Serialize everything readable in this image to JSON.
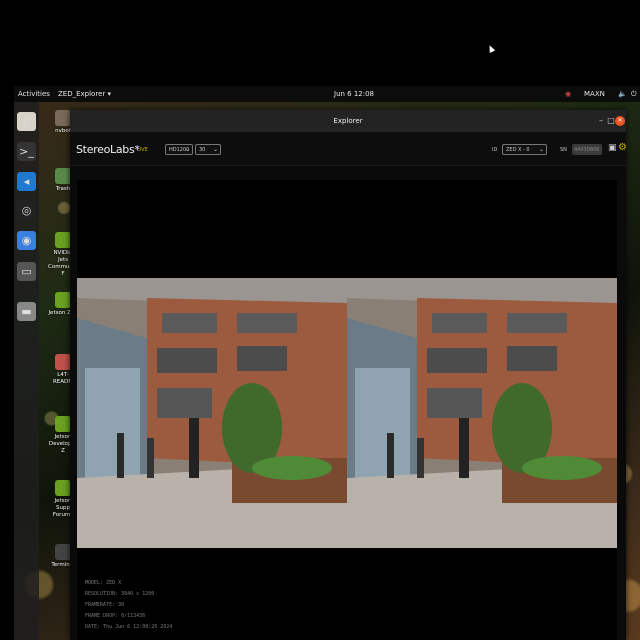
{
  "topbar": {
    "activities": "Activities",
    "app_menu": "ZED_Explorer ▾",
    "clock": "Jun 6  12:08",
    "power_mode": "MAXN",
    "status_icons": "🔈 ⏻"
  },
  "dock": {
    "items": [
      {
        "icon": "files-icon",
        "glyph": "▯",
        "color": "#d8d2c8"
      },
      {
        "icon": "terminal-icon",
        "glyph": ">_",
        "color": "#333"
      },
      {
        "icon": "vscode-icon",
        "glyph": "◂",
        "color": "#1e7ad0"
      },
      {
        "icon": "obs-icon",
        "glyph": "◎",
        "color": "#222"
      },
      {
        "icon": "chromium-icon",
        "glyph": "◉",
        "color": "#3a7ee0"
      },
      {
        "icon": "app-icon",
        "glyph": "▭",
        "color": "#555"
      },
      {
        "icon": "drive-icon",
        "glyph": "▬",
        "color": "#888"
      }
    ]
  },
  "desktop": {
    "icons": [
      {
        "label": "nvbot",
        "icon": "home-folder-icon",
        "color": "#7a6a5a"
      },
      {
        "label": "Trash",
        "icon": "trash-icon",
        "color": "#5a8a4a"
      },
      {
        "label": "NVIDIA Jets\nCommunity F",
        "icon": "nvidia-icon",
        "color": "#6aa121"
      },
      {
        "label": "Jetson Zoo",
        "icon": "nvidia-icon",
        "color": "#6aa121"
      },
      {
        "label": "L4T-READM",
        "icon": "folder-icon",
        "color": "#c0504a"
      },
      {
        "label": "Jetson\nDeveloper Z",
        "icon": "nvidia-icon",
        "color": "#6aa121"
      },
      {
        "label": "Jetson Supp\nForums",
        "icon": "nvidia-icon",
        "color": "#6aa121"
      },
      {
        "label": "Terminal",
        "icon": "terminal-icon",
        "color": "#444"
      }
    ]
  },
  "window": {
    "title": "Explorer",
    "minimize": "–",
    "maximize": "□",
    "close": "×"
  },
  "toolbar": {
    "brand": "StereoLabs*",
    "live": "LIVE",
    "resolution": "HD1200",
    "fps": "30",
    "sn_label": "ID",
    "serial_select": "ZED X - 0",
    "sn_badge": "SN",
    "sn_value": "44030806"
  },
  "info": {
    "model": "MODEL: ZED X",
    "resolution": "RESOLUTION: 3840 x 1200",
    "framerate": "FRAMERATE: 30",
    "frame_drop": "FRAME DROP: 0/113436",
    "date": "DATE: Thu Jun 6 12:08:20 2024"
  },
  "colors": {
    "accent": "#c9b400",
    "close_button": "#e95420"
  }
}
